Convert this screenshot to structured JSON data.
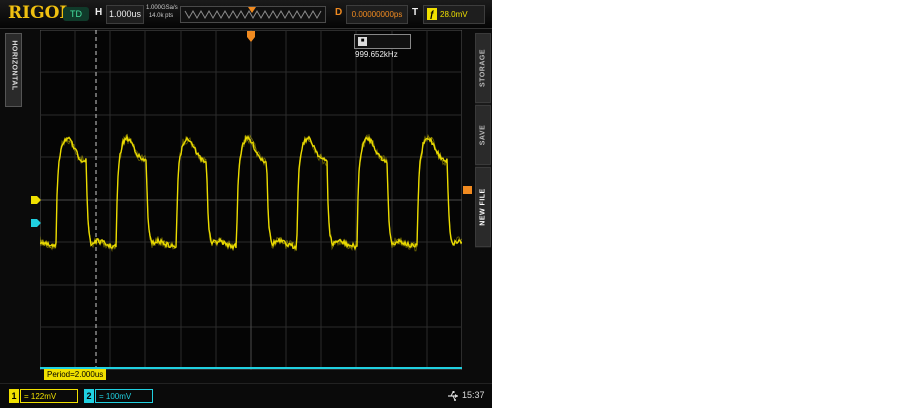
{
  "topbar": {
    "brand": "RIGOL",
    "run_state": "TD",
    "h_label": "H",
    "timebase": "1.000us",
    "sample_rate": "1.000GSa/s",
    "memory_depth": "14.0k pts",
    "d_label": "D",
    "delay": "0.00000000ps",
    "t_label": "T",
    "trigger_level": "28.0mV"
  },
  "menus": {
    "left": "HORIZONTAL",
    "right": [
      "STORAGE",
      "SAVE",
      "NEW FILE"
    ]
  },
  "measurement": {
    "frequency": "999.652kHz",
    "period": "Period=2.000us"
  },
  "channels": [
    {
      "number": "1",
      "scale": "= 122mV",
      "color": "#f0e000"
    },
    {
      "number": "2",
      "scale": "= 100mV",
      "color": "#20d0e0"
    }
  ],
  "status": {
    "time": "15:37",
    "icon": "usb-icon"
  },
  "colors": {
    "ch1": "#f0e000",
    "ch2": "#20d0e0",
    "trigger": "#f08a20",
    "brand": "#f0c010"
  }
}
